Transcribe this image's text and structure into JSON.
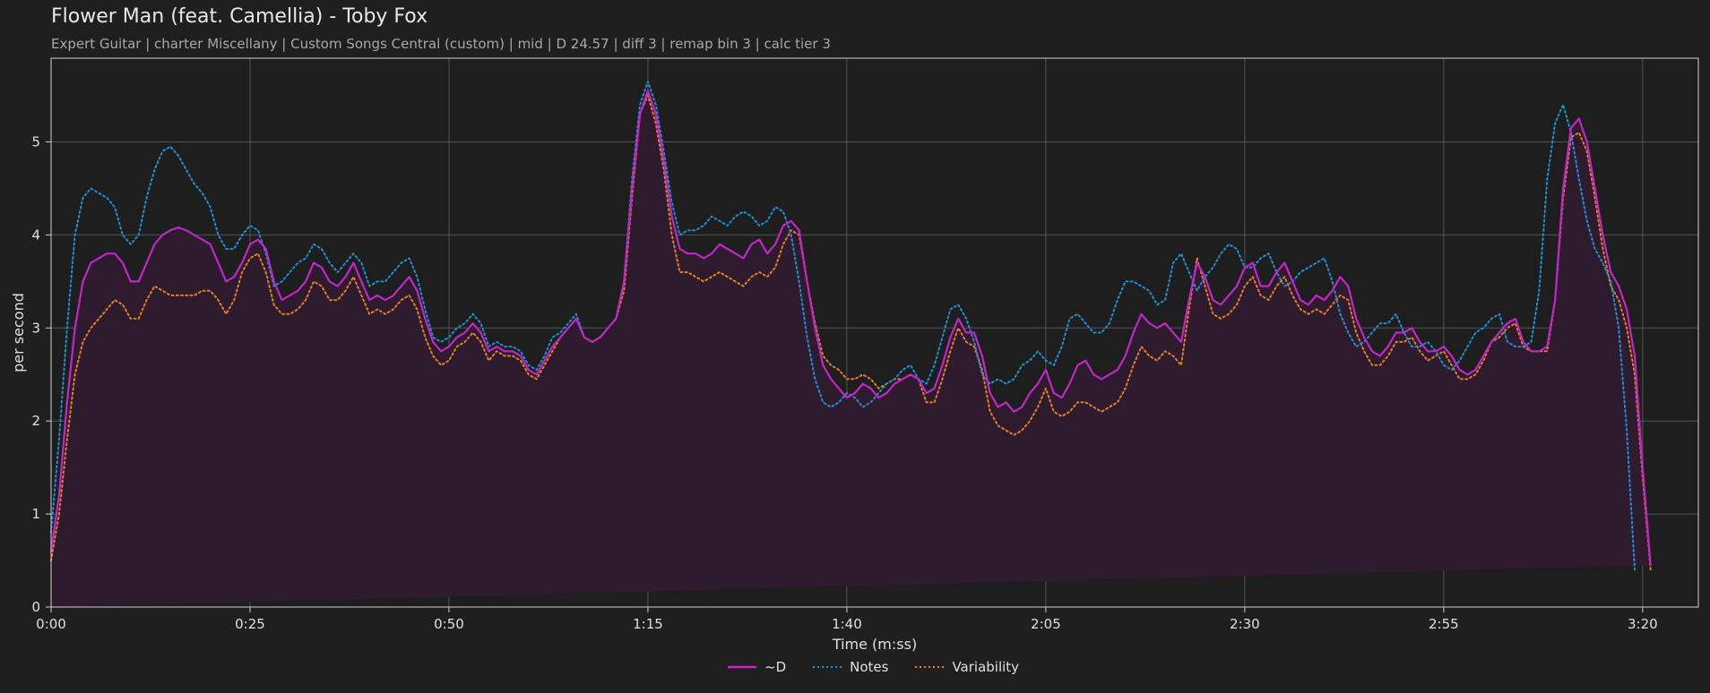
{
  "title": "Flower Man (feat. Camellia) - Toby Fox",
  "subtitle": "Expert Guitar  |  charter Miscellany  |  Custom Songs Central (custom)  |  mid  |  D 24.57  |  diff 3  |  remap bin 3  |  calc tier 3",
  "colors": {
    "background": "#1f1f1f",
    "plot_background": "#1e1e1e",
    "grid": "#555555",
    "d_line": "#c026c8",
    "d_fill": "#2e1b2e",
    "notes_line": "#1f8fd0",
    "variability_line": "#e67e22",
    "text": "#e0e0e0"
  },
  "chart_data": {
    "type": "line",
    "xlabel": "Time (m:ss)",
    "ylabel": "per second",
    "xlim": [
      0,
      207
    ],
    "ylim": [
      0,
      5.9
    ],
    "x_ticks": [
      0,
      25,
      50,
      75,
      100,
      125,
      150,
      175,
      200
    ],
    "x_tick_labels": [
      "0:00",
      "0:25",
      "0:50",
      "1:15",
      "1:40",
      "2:05",
      "2:30",
      "2:55",
      "3:20"
    ],
    "y_ticks": [
      0,
      1,
      2,
      3,
      4,
      5
    ],
    "y_tick_labels": [
      "0",
      "1",
      "2",
      "3",
      "4",
      "5"
    ],
    "grid": true,
    "legend_position": "bottom-center",
    "x": [
      0,
      1,
      2,
      3,
      4,
      5,
      6,
      7,
      8,
      9,
      10,
      11,
      12,
      13,
      14,
      15,
      16,
      17,
      18,
      19,
      20,
      21,
      22,
      23,
      24,
      25,
      26,
      27,
      28,
      29,
      30,
      31,
      32,
      33,
      34,
      35,
      36,
      37,
      38,
      39,
      40,
      41,
      42,
      43,
      44,
      45,
      46,
      47,
      48,
      49,
      50,
      51,
      52,
      53,
      54,
      55,
      56,
      57,
      58,
      59,
      60,
      61,
      62,
      63,
      64,
      65,
      66,
      67,
      68,
      69,
      70,
      71,
      72,
      73,
      74,
      75,
      76,
      77,
      78,
      79,
      80,
      81,
      82,
      83,
      84,
      85,
      86,
      87,
      88,
      89,
      90,
      91,
      92,
      93,
      94,
      95,
      96,
      97,
      98,
      99,
      100,
      101,
      102,
      103,
      104,
      105,
      106,
      107,
      108,
      109,
      110,
      111,
      112,
      113,
      114,
      115,
      116,
      117,
      118,
      119,
      120,
      121,
      122,
      123,
      124,
      125,
      126,
      127,
      128,
      129,
      130,
      131,
      132,
      133,
      134,
      135,
      136,
      137,
      138,
      139,
      140,
      141,
      142,
      143,
      144,
      145,
      146,
      147,
      148,
      149,
      150,
      151,
      152,
      153,
      154,
      155,
      156,
      157,
      158,
      159,
      160,
      161,
      162,
      163,
      164,
      165,
      166,
      167,
      168,
      169,
      170,
      171,
      172,
      173,
      174,
      175,
      176,
      177,
      178,
      179,
      180,
      181,
      182,
      183,
      184,
      185,
      186,
      187,
      188,
      189,
      190,
      191,
      192,
      193,
      194,
      195,
      196,
      197,
      198,
      199,
      200,
      201,
      202,
      203,
      204,
      205,
      206,
      207
    ],
    "series": [
      {
        "name": "~D",
        "style": "solid",
        "values": [
          0.6,
          1.2,
          2.2,
          3.0,
          3.5,
          3.7,
          3.75,
          3.8,
          3.8,
          3.7,
          3.5,
          3.5,
          3.7,
          3.9,
          4.0,
          4.05,
          4.08,
          4.05,
          4.0,
          3.95,
          3.9,
          3.7,
          3.5,
          3.55,
          3.7,
          3.9,
          3.95,
          3.85,
          3.5,
          3.3,
          3.35,
          3.4,
          3.5,
          3.7,
          3.65,
          3.5,
          3.45,
          3.55,
          3.7,
          3.5,
          3.3,
          3.35,
          3.3,
          3.35,
          3.45,
          3.55,
          3.4,
          3.1,
          2.85,
          2.75,
          2.8,
          2.9,
          2.95,
          3.05,
          2.95,
          2.75,
          2.8,
          2.75,
          2.75,
          2.7,
          2.55,
          2.5,
          2.65,
          2.8,
          2.9,
          3.0,
          3.1,
          2.9,
          2.85,
          2.9,
          3.0,
          3.1,
          3.5,
          4.5,
          5.3,
          5.55,
          5.3,
          4.8,
          4.2,
          3.85,
          3.8,
          3.8,
          3.75,
          3.8,
          3.9,
          3.85,
          3.8,
          3.75,
          3.9,
          3.95,
          3.8,
          3.9,
          4.1,
          4.15,
          4.05,
          3.5,
          3.0,
          2.6,
          2.45,
          2.35,
          2.25,
          2.3,
          2.4,
          2.35,
          2.25,
          2.3,
          2.4,
          2.45,
          2.5,
          2.45,
          2.3,
          2.35,
          2.6,
          2.9,
          3.1,
          2.95,
          2.95,
          2.7,
          2.3,
          2.15,
          2.2,
          2.1,
          2.15,
          2.3,
          2.4,
          2.55,
          2.3,
          2.25,
          2.4,
          2.6,
          2.65,
          2.5,
          2.45,
          2.5,
          2.55,
          2.7,
          2.95,
          3.15,
          3.05,
          3.0,
          3.05,
          2.95,
          2.85,
          3.3,
          3.7,
          3.55,
          3.3,
          3.25,
          3.35,
          3.45,
          3.65,
          3.7,
          3.45,
          3.45,
          3.6,
          3.7,
          3.5,
          3.3,
          3.25,
          3.35,
          3.3,
          3.4,
          3.55,
          3.45,
          3.1,
          2.9,
          2.75,
          2.7,
          2.8,
          2.95,
          2.95,
          3.0,
          2.85,
          2.75,
          2.75,
          2.8,
          2.7,
          2.55,
          2.5,
          2.55,
          2.7,
          2.85,
          2.95,
          3.05,
          3.1,
          2.85,
          2.75,
          2.75,
          2.8,
          3.3,
          4.5,
          5.15,
          5.25,
          5.0,
          4.5,
          4.0,
          3.6,
          3.45,
          3.2,
          2.7,
          1.5,
          0.45
        ]
      },
      {
        "name": "Notes",
        "style": "dotted",
        "values": [
          0.8,
          1.8,
          3.0,
          4.0,
          4.4,
          4.5,
          4.45,
          4.4,
          4.3,
          4.0,
          3.9,
          4.0,
          4.4,
          4.7,
          4.9,
          4.95,
          4.85,
          4.7,
          4.55,
          4.45,
          4.3,
          4.0,
          3.85,
          3.85,
          4.0,
          4.1,
          4.05,
          3.8,
          3.45,
          3.5,
          3.6,
          3.7,
          3.75,
          3.9,
          3.85,
          3.7,
          3.6,
          3.7,
          3.8,
          3.7,
          3.45,
          3.5,
          3.5,
          3.6,
          3.7,
          3.75,
          3.55,
          3.2,
          2.9,
          2.85,
          2.9,
          3.0,
          3.05,
          3.15,
          3.05,
          2.8,
          2.85,
          2.8,
          2.8,
          2.75,
          2.6,
          2.55,
          2.7,
          2.9,
          2.95,
          3.05,
          3.15,
          2.9,
          2.85,
          2.9,
          3.0,
          3.1,
          3.5,
          4.6,
          5.4,
          5.65,
          5.4,
          4.9,
          4.35,
          4.0,
          4.05,
          4.05,
          4.1,
          4.2,
          4.15,
          4.1,
          4.2,
          4.25,
          4.2,
          4.1,
          4.15,
          4.3,
          4.25,
          4.0,
          3.5,
          2.9,
          2.45,
          2.2,
          2.15,
          2.2,
          2.3,
          2.25,
          2.15,
          2.2,
          2.3,
          2.4,
          2.45,
          2.55,
          2.6,
          2.45,
          2.4,
          2.6,
          2.9,
          3.2,
          3.25,
          3.1,
          2.85,
          2.5,
          2.4,
          2.45,
          2.4,
          2.45,
          2.6,
          2.65,
          2.75,
          2.65,
          2.6,
          2.8,
          3.1,
          3.15,
          3.05,
          2.95,
          2.95,
          3.05,
          3.3,
          3.5,
          3.5,
          3.45,
          3.4,
          3.25,
          3.3,
          3.7,
          3.8,
          3.6,
          3.4,
          3.55,
          3.65,
          3.8,
          3.9,
          3.85,
          3.65,
          3.65,
          3.75,
          3.8,
          3.6,
          3.45,
          3.5,
          3.6,
          3.65,
          3.7,
          3.75,
          3.5,
          3.15,
          2.95,
          2.8,
          2.85,
          2.95,
          3.05,
          3.05,
          3.15,
          2.95,
          2.8,
          2.8,
          2.85,
          2.75,
          2.6,
          2.55,
          2.65,
          2.8,
          2.95,
          3.0,
          3.1,
          3.15,
          2.85,
          2.8,
          2.8,
          2.85,
          3.4,
          4.6,
          5.2,
          5.4,
          5.1,
          4.6,
          4.15,
          3.85,
          3.7,
          3.5,
          3.0,
          1.9,
          0.4
        ]
      },
      {
        "name": "Variability",
        "style": "dotted",
        "values": [
          0.5,
          1.0,
          1.8,
          2.5,
          2.85,
          3.0,
          3.1,
          3.2,
          3.3,
          3.25,
          3.1,
          3.1,
          3.3,
          3.45,
          3.4,
          3.35,
          3.35,
          3.35,
          3.35,
          3.4,
          3.4,
          3.3,
          3.15,
          3.3,
          3.6,
          3.75,
          3.8,
          3.6,
          3.25,
          3.15,
          3.15,
          3.2,
          3.3,
          3.5,
          3.45,
          3.3,
          3.3,
          3.4,
          3.55,
          3.35,
          3.15,
          3.2,
          3.15,
          3.2,
          3.3,
          3.35,
          3.2,
          2.9,
          2.7,
          2.6,
          2.65,
          2.8,
          2.85,
          2.95,
          2.85,
          2.65,
          2.75,
          2.7,
          2.7,
          2.65,
          2.5,
          2.45,
          2.6,
          2.75,
          2.9,
          3.0,
          3.1,
          2.9,
          2.85,
          2.9,
          3.0,
          3.1,
          3.4,
          4.4,
          5.3,
          5.5,
          5.2,
          4.7,
          4.0,
          3.6,
          3.6,
          3.55,
          3.5,
          3.55,
          3.6,
          3.55,
          3.5,
          3.45,
          3.55,
          3.6,
          3.55,
          3.65,
          3.9,
          4.05,
          4.0,
          3.5,
          3.05,
          2.7,
          2.6,
          2.55,
          2.45,
          2.45,
          2.5,
          2.45,
          2.35,
          2.4,
          2.45,
          2.45,
          2.5,
          2.45,
          2.2,
          2.2,
          2.45,
          2.75,
          3.0,
          2.85,
          2.8,
          2.55,
          2.1,
          1.95,
          1.9,
          1.85,
          1.9,
          2.0,
          2.15,
          2.35,
          2.1,
          2.05,
          2.1,
          2.2,
          2.2,
          2.15,
          2.1,
          2.15,
          2.2,
          2.35,
          2.6,
          2.8,
          2.7,
          2.65,
          2.75,
          2.7,
          2.6,
          3.2,
          3.75,
          3.45,
          3.15,
          3.1,
          3.15,
          3.25,
          3.45,
          3.55,
          3.35,
          3.3,
          3.45,
          3.55,
          3.35,
          3.2,
          3.15,
          3.2,
          3.15,
          3.25,
          3.35,
          3.3,
          2.95,
          2.75,
          2.6,
          2.6,
          2.7,
          2.85,
          2.85,
          2.9,
          2.75,
          2.65,
          2.7,
          2.75,
          2.6,
          2.45,
          2.45,
          2.5,
          2.65,
          2.85,
          2.9,
          3.0,
          3.05,
          2.8,
          2.75,
          2.75,
          2.75,
          3.3,
          4.4,
          5.05,
          5.1,
          4.9,
          4.4,
          3.85,
          3.45,
          3.3,
          3.0,
          2.5,
          1.4,
          0.4
        ]
      }
    ]
  }
}
